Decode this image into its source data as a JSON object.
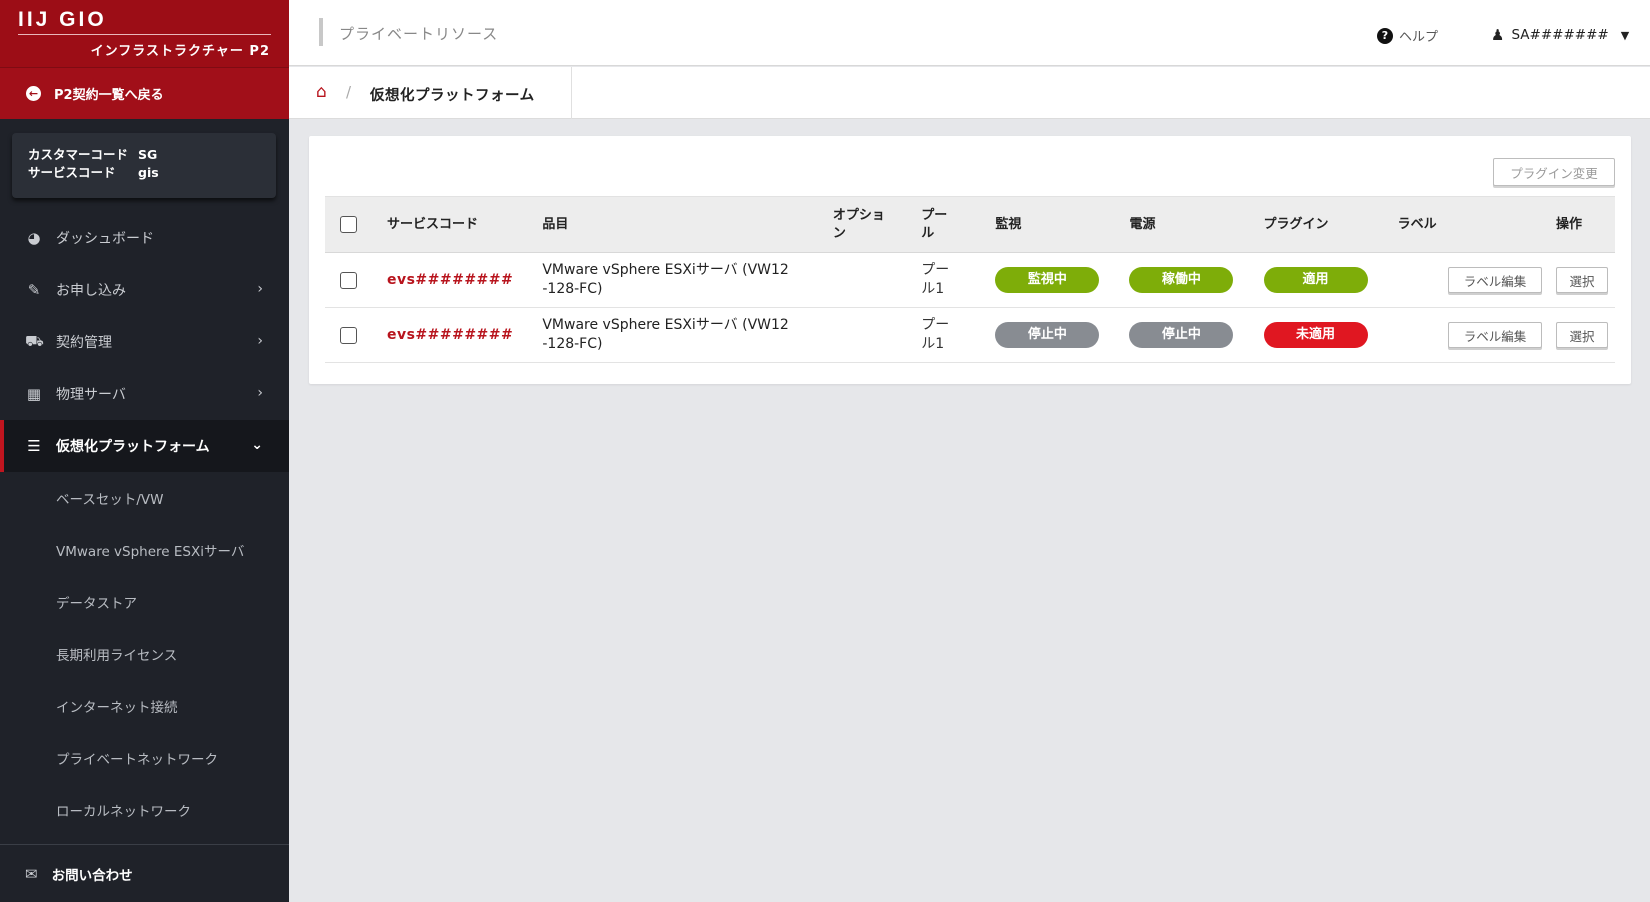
{
  "brand": {
    "logo": "IIJ GIO",
    "subtitle": "インフラストラクチャー P2"
  },
  "back_link": "P2契約一覧へ戻る",
  "codes": {
    "customer_label": "カスタマーコード",
    "customer_value": "SG",
    "service_label": "サービスコード",
    "service_value": "gis"
  },
  "nav": {
    "dashboard": "ダッシュボード",
    "application": "お申し込み",
    "contract": "契約管理",
    "physical": "物理サーバ",
    "virtual": "仮想化プラットフォーム",
    "sub": [
      "ベースセット/VW",
      "VMware vSphere ESXiサーバ",
      "データストア",
      "長期利用ライセンス",
      "インターネット接続",
      "プライベートネットワーク",
      "ローカルネットワーク"
    ],
    "contact": "お問い合わせ"
  },
  "topbar": {
    "title": "プライベートリソース",
    "help": "ヘルプ",
    "user": "SA#######"
  },
  "breadcrumb": {
    "current": "仮想化プラットフォーム"
  },
  "panel": {
    "plugin_button": "プラグイン変更"
  },
  "table": {
    "headers": {
      "service_code": "サービスコード",
      "item": "品目",
      "option": "オプション",
      "pool": "プール",
      "monitor": "監視",
      "power": "電源",
      "plugin": "プラグイン",
      "label": "ラベル",
      "action": "操作"
    },
    "rows": [
      {
        "service_code": "evs########",
        "item_line1": "VMware vSphere ESXiサーバ (VW12",
        "item_line2": "-128-FC)",
        "option": "",
        "pool_line1": "プー",
        "pool_line2": "ル1",
        "monitor": "監視中",
        "power": "稼働中",
        "plugin": "適用",
        "label_button": "ラベル編集",
        "select_button": "選択"
      },
      {
        "service_code": "evs########",
        "item_line1": "VMware vSphere ESXiサーバ (VW12",
        "item_line2": "-128-FC)",
        "option": "",
        "pool_line1": "プー",
        "pool_line2": "ル1",
        "monitor": "停止中",
        "power": "停止中",
        "plugin": "未適用",
        "label_button": "ラベル編集",
        "select_button": "選択"
      }
    ]
  },
  "colors": {
    "brand_red": "#9c0d16",
    "sidebar_bg": "#1f2229",
    "status_green": "#7ead09",
    "status_gray": "#888c92",
    "status_red": "#e01721"
  }
}
